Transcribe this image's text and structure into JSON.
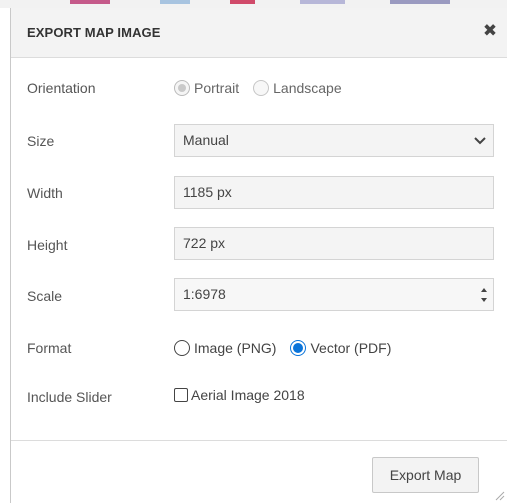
{
  "dialog": {
    "title": "EXPORT MAP IMAGE",
    "close_icon": "close-icon"
  },
  "orientation": {
    "label": "Orientation",
    "options": [
      {
        "label": "Portrait",
        "state": "checked-disabled"
      },
      {
        "label": "Landscape",
        "state": "unchecked-disabled"
      }
    ]
  },
  "size": {
    "label": "Size",
    "value": "Manual",
    "icon": "chevron-down-icon"
  },
  "width": {
    "label": "Width",
    "value": "1185 px"
  },
  "height": {
    "label": "Height",
    "value": "722 px"
  },
  "scale": {
    "label": "Scale",
    "value": "1:6978",
    "icon": "spinner-arrows-icon"
  },
  "format": {
    "label": "Format",
    "options": [
      {
        "label": "Image (PNG)",
        "state": "unchecked"
      },
      {
        "label": "Vector (PDF)",
        "state": "checked"
      }
    ],
    "accent_color": "#0a74da"
  },
  "include_slider": {
    "label": "Include Slider",
    "checkbox_label": "Aerial Image 2018",
    "checked": false
  },
  "footer": {
    "export_label": "Export Map"
  }
}
